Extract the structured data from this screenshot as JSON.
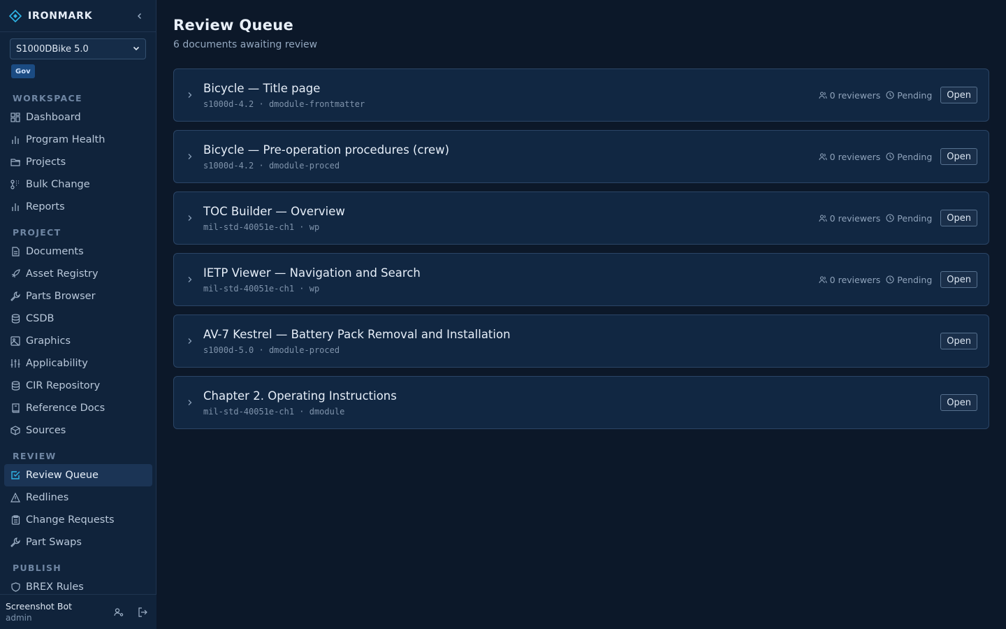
{
  "brand": {
    "name": "IRONMARK"
  },
  "project_select": {
    "value": "S1000DBike 5.0"
  },
  "badge": "Gov",
  "nav": {
    "workspace": {
      "label": "WORKSPACE",
      "items": [
        {
          "label": "Dashboard",
          "icon": "grid-icon"
        },
        {
          "label": "Program Health",
          "icon": "bar-chart-icon"
        },
        {
          "label": "Projects",
          "icon": "folder-icon"
        },
        {
          "label": "Bulk Change",
          "icon": "shuffle-icon"
        },
        {
          "label": "Reports",
          "icon": "bar-chart-icon"
        }
      ]
    },
    "project": {
      "label": "PROJECT",
      "items": [
        {
          "label": "Documents",
          "icon": "file-icon"
        },
        {
          "label": "Asset Registry",
          "icon": "rocket-icon"
        },
        {
          "label": "Parts Browser",
          "icon": "wrench-icon"
        },
        {
          "label": "CSDB",
          "icon": "database-icon"
        },
        {
          "label": "Graphics",
          "icon": "image-icon"
        },
        {
          "label": "Applicability",
          "icon": "sliders-icon"
        },
        {
          "label": "CIR Repository",
          "icon": "database-icon"
        },
        {
          "label": "Reference Docs",
          "icon": "book-icon"
        },
        {
          "label": "Sources",
          "icon": "package-icon"
        }
      ]
    },
    "review": {
      "label": "REVIEW",
      "items": [
        {
          "label": "Review Queue",
          "icon": "check-square-icon",
          "active": true
        },
        {
          "label": "Redlines",
          "icon": "alert-triangle-icon"
        },
        {
          "label": "Change Requests",
          "icon": "clipboard-icon"
        },
        {
          "label": "Part Swaps",
          "icon": "wrench-icon"
        }
      ]
    },
    "publish": {
      "label": "PUBLISH",
      "items": [
        {
          "label": "BREX Rules",
          "icon": "shield-icon"
        }
      ]
    }
  },
  "user": {
    "name": "Screenshot Bot",
    "role": "admin"
  },
  "page": {
    "title": "Review Queue",
    "subtitle": "6 documents awaiting review"
  },
  "documents": [
    {
      "title": "Bicycle — Title page",
      "spec": "s1000d-4.2",
      "type": "dmodule-frontmatter",
      "reviewers": "0 reviewers",
      "status": "Pending",
      "action": "Open"
    },
    {
      "title": "Bicycle — Pre-operation procedures (crew)",
      "spec": "s1000d-4.2",
      "type": "dmodule-proced",
      "reviewers": "0 reviewers",
      "status": "Pending",
      "action": "Open"
    },
    {
      "title": "TOC Builder — Overview",
      "spec": "mil-std-40051e-ch1",
      "type": "wp",
      "reviewers": "0 reviewers",
      "status": "Pending",
      "action": "Open"
    },
    {
      "title": "IETP Viewer — Navigation and Search",
      "spec": "mil-std-40051e-ch1",
      "type": "wp",
      "reviewers": "0 reviewers",
      "status": "Pending",
      "action": "Open"
    },
    {
      "title": "AV-7 Kestrel — Battery Pack Removal and Installation",
      "spec": "s1000d-5.0",
      "type": "dmodule-proced",
      "action": "Open"
    },
    {
      "title": "Chapter 2. Operating Instructions",
      "spec": "mil-std-40051e-ch1",
      "type": "dmodule",
      "action": "Open"
    }
  ],
  "colors": {
    "background": "#0c1829",
    "sidebar": "#10233b",
    "card": "#112742",
    "accent": "#2fb5e6",
    "badge": "#1b4b82"
  }
}
